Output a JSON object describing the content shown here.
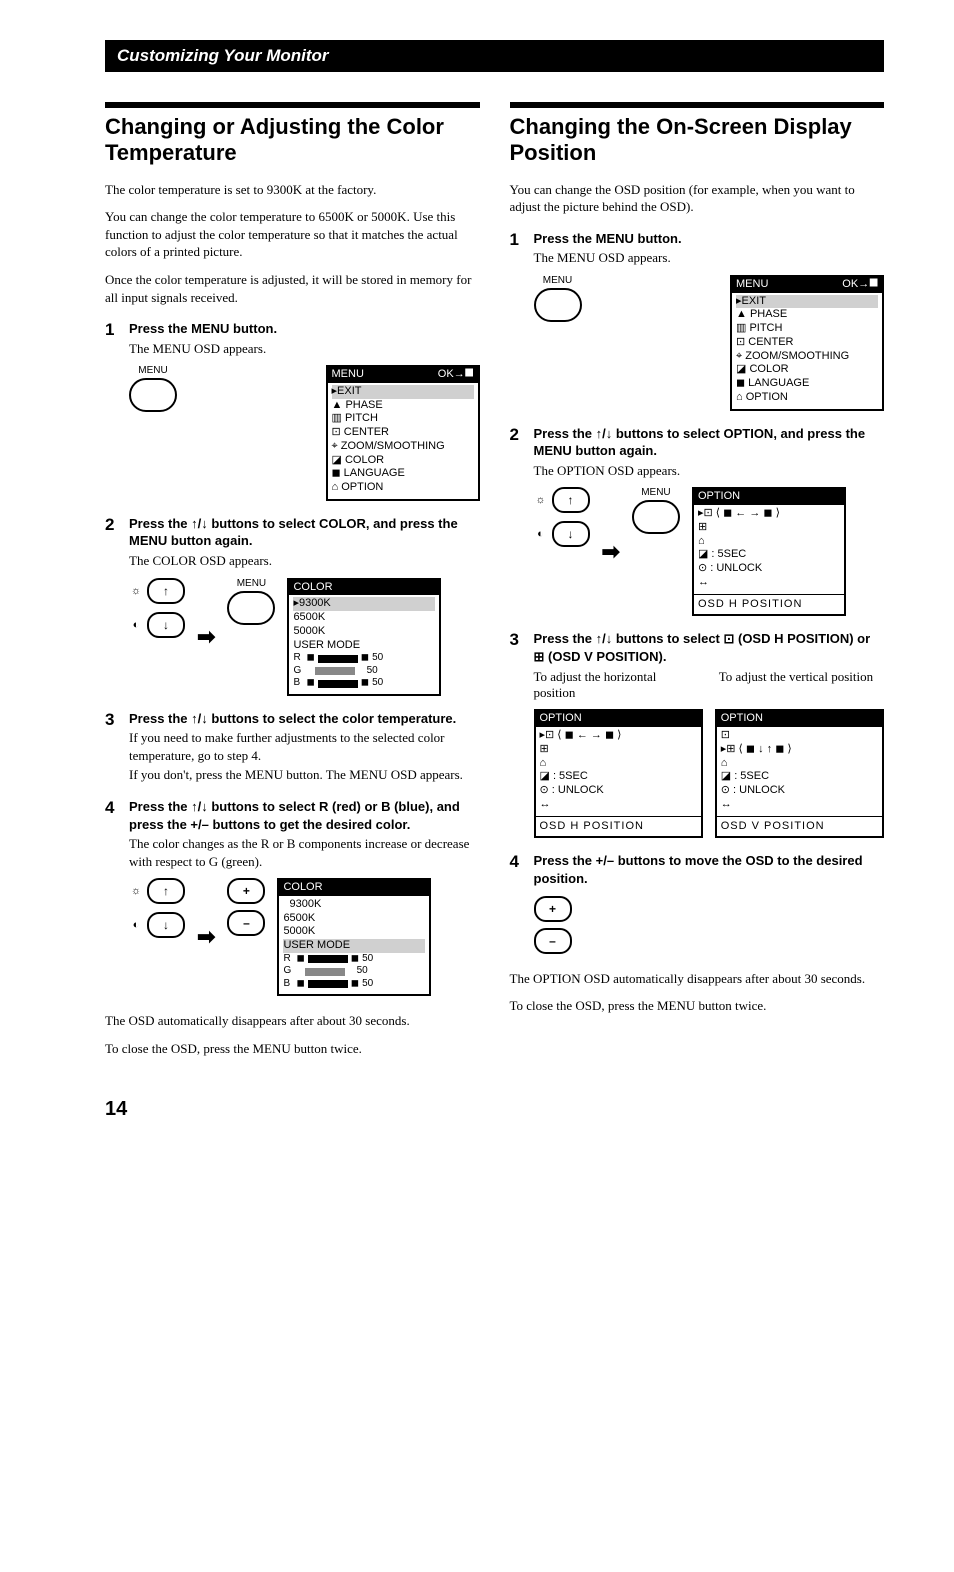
{
  "sectionHeader": "Customizing Your Monitor",
  "left": {
    "title": "Changing or Adjusting the Color Temperature",
    "intro1": "The color temperature is set to 9300K at the factory.",
    "intro2": "You can change the color temperature to 6500K or 5000K. Use this function to adjust the color temperature so that it matches the actual colors of a printed picture.",
    "intro3": "Once the color temperature is adjusted, it will be stored in memory for all input signals received.",
    "s1h": "Press the MENU button.",
    "s1s": "The MENU OSD appears.",
    "menuLabel": "MENU",
    "osdMenuTitle_l": "MENU",
    "osdMenuTitle_r": "OK→⯀",
    "osdMenu1": "▸EXIT",
    "osdMenu2": "  ▲ PHASE",
    "osdMenu3": "  ▥ PITCH",
    "osdMenu4": "  ⊡ CENTER",
    "osdMenu5": "  ⌖ ZOOM/SMOOTHING",
    "osdMenu6": "  ◪ COLOR",
    "osdMenu7": "  ◼ LANGUAGE",
    "osdMenu8": "  ⌂ OPTION",
    "s2h": "Press the ↑/↓ buttons to select COLOR, and press the MENU button again.",
    "s2s": "The COLOR OSD appears.",
    "osdColorTitle": "COLOR",
    "osdColor1": "▸9300K",
    "osdColor2": "  6500K",
    "osdColor3": "  5000K",
    "osdColor4": "  USER MODE",
    "rgbR": "R",
    "rgbG": "G",
    "rgbB": "B",
    "rgbVal": "50",
    "s3h": "Press the ↑/↓ buttons to select the color temperature.",
    "s3s1": "If you need to make further adjustments to the selected color temperature, go to step 4.",
    "s3s2": "If you don't, press the MENU button. The MENU OSD appears.",
    "s4h": "Press the ↑/↓ buttons to select R (red) or B (blue), and press the +/– buttons to get the desired color.",
    "s4s": "The color changes as the R or B components increase or decrease with respect to G (green).",
    "osdColor4b": "  USER MODE",
    "plus": "+",
    "minus": "–",
    "closing1": "The OSD automatically disappears after about 30 seconds.",
    "closing2": "To close the OSD, press the MENU button twice."
  },
  "right": {
    "title": "Changing the On-Screen Display Position",
    "intro1": "You can change the OSD position (for example, when you want to adjust the picture behind the OSD).",
    "s1h": "Press the MENU button.",
    "s1s": "The MENU OSD appears.",
    "s2h": "Press the ↑/↓ buttons to select OPTION, and press the MENU button again.",
    "s2s": "The OPTION OSD appears.",
    "osdOptionTitle": "OPTION",
    "osdOpt1": "▸⊡  ⟨ ◼ ←   → ◼ ⟩",
    "osdOpt2": "  ⊞",
    "osdOpt3": "  ⌂",
    "osdOpt4": "  ◪ :  5SEC",
    "osdOpt5": "  ⊙ :  UNLOCK",
    "osdOpt6": "  ↔",
    "osdOptFooter1": "OSD  H  POSITION",
    "osdOptFooter2": "OSD  V  POSITION",
    "s3h": "Press the ↑/↓ buttons to select ⊡ (OSD H POSITION) or ⊞ (OSD V POSITION).",
    "hintH": "To adjust the horizontal position",
    "hintV": "To adjust the vertical position",
    "osdOptV1": "  ⊡",
    "osdOptV2": "▸⊞  ⟨ ◼ ↓   ↑ ◼ ⟩",
    "s4h": "Press the +/– buttons to move the OSD to the desired position.",
    "closing1": "The OPTION OSD automatically disappears after about 30 seconds.",
    "closing2": "To close the OSD, press the MENU button twice."
  },
  "pageNumber": "14"
}
